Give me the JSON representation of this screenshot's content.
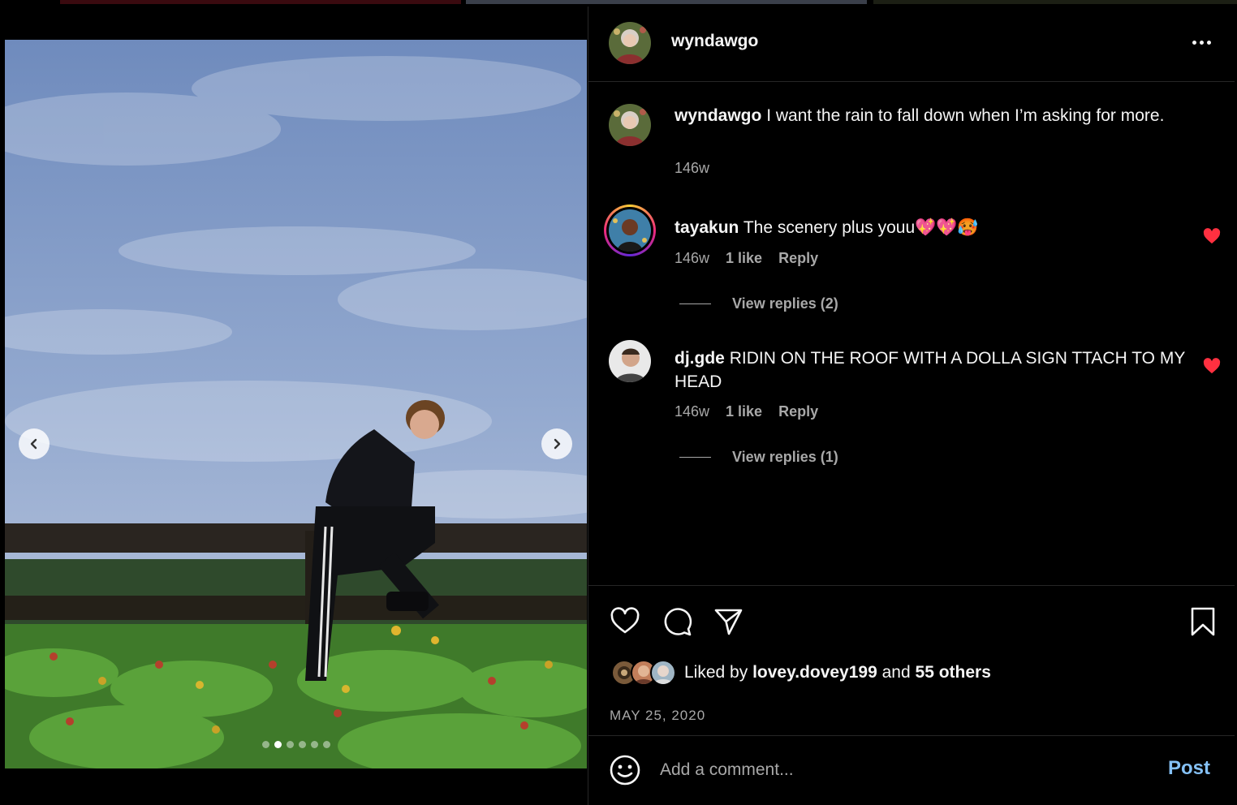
{
  "post": {
    "author": "wyndawgo",
    "more_icon": "more-horizontal-icon",
    "caption": {
      "username": "wyndawgo",
      "text": "I want the rain to fall down when I’m asking for more.",
      "time": "146w"
    },
    "carousel": {
      "slide_count": 6,
      "active_slide": 2,
      "prev_icon": "chevron-left-icon",
      "next_icon": "chevron-right-icon"
    }
  },
  "comments": [
    {
      "username": "tayakun",
      "text": "The scenery plus youu💖💖🥵",
      "time": "146w",
      "likes": "1 like",
      "reply_label": "Reply",
      "view_replies": "View replies (2)",
      "liked": true
    },
    {
      "username": "dj.gde",
      "text": "RIDIN ON THE ROOF WITH A DOLLA SIGN TTACH TO MY HEAD",
      "time": "146w",
      "likes": "1 like",
      "reply_label": "Reply",
      "view_replies": "View replies (1)",
      "liked": true
    }
  ],
  "actions": {
    "like_icon": "heart-icon",
    "comment_icon": "comment-icon",
    "share_icon": "share-icon",
    "save_icon": "bookmark-icon"
  },
  "likes": {
    "prefix": "Liked by",
    "user": "lovey.dovey199",
    "joiner": "and",
    "others": "55 others"
  },
  "date": "MAY 25, 2020",
  "comment_box": {
    "emoji_icon": "emoji-icon",
    "placeholder": "Add a comment...",
    "post_label": "Post"
  },
  "colors": {
    "background": "#000000",
    "text": "#f5f5f5",
    "secondary_text": "#a8a8a8",
    "divider": "#262626",
    "like_red": "#ff3040",
    "post_blue": "#85c1f6"
  }
}
